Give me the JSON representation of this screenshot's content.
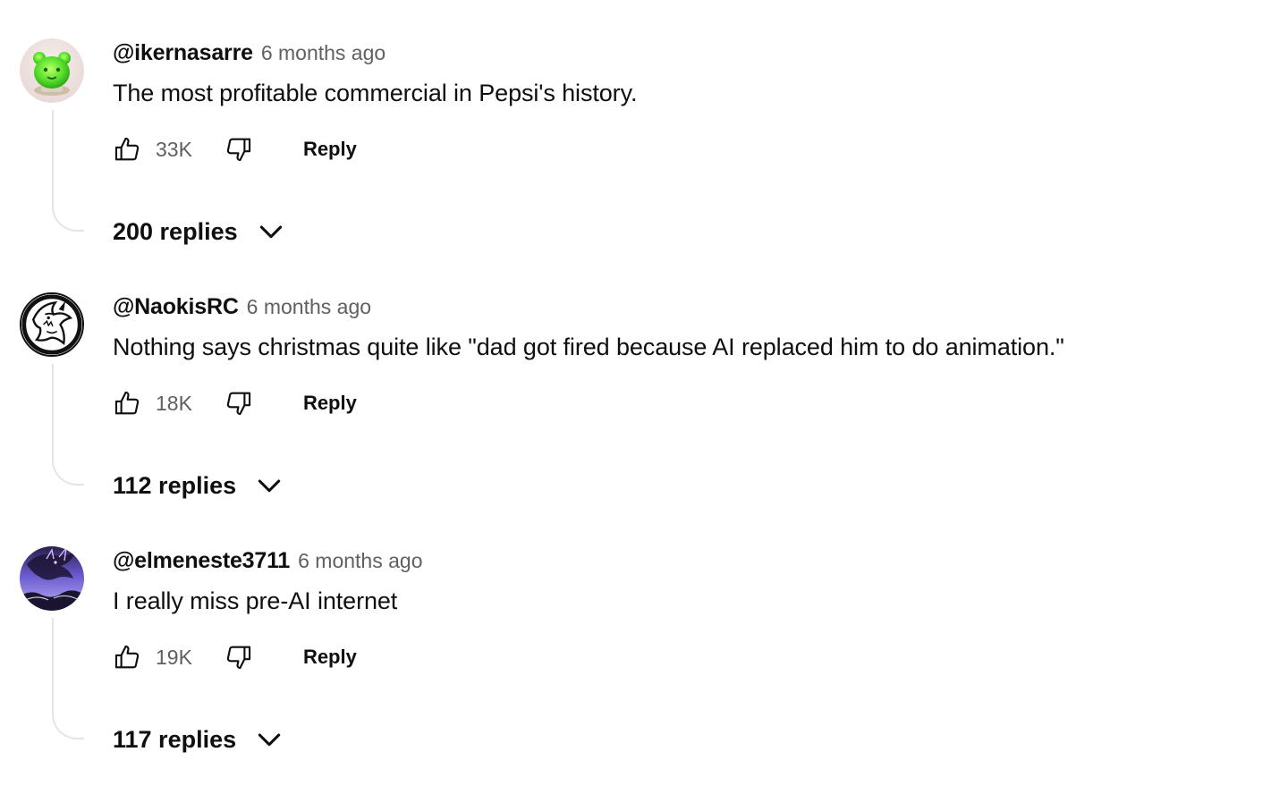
{
  "comments": [
    {
      "author": "@ikernasarre",
      "time": "6 months ago",
      "text": "The most profitable commercial in Pepsi's history.",
      "likes": "33K",
      "reply_label": "Reply",
      "replies_label": "200 replies",
      "avatar_icon": "green-creature-avatar-icon"
    },
    {
      "author": "@NaokisRC",
      "time": "6 months ago",
      "text": "Nothing says christmas quite like \"dad got fired because AI replaced him to do animation.\"",
      "likes": "18K",
      "reply_label": "Reply",
      "replies_label": "112 replies",
      "avatar_icon": "shark-emblem-avatar-icon"
    },
    {
      "author": "@elmeneste3711",
      "time": "6 months ago",
      "text": "I really miss pre-AI internet",
      "likes": "19K",
      "reply_label": "Reply",
      "replies_label": "117 replies",
      "avatar_icon": "purple-dragon-avatar-icon"
    }
  ],
  "icons": {
    "like": "thumbs-up-icon",
    "dislike": "thumbs-down-icon",
    "expand": "chevron-down-icon"
  },
  "colors": {
    "text_primary": "#0f0f0f",
    "text_secondary": "#606060",
    "thread_line": "#e5e5e5"
  }
}
